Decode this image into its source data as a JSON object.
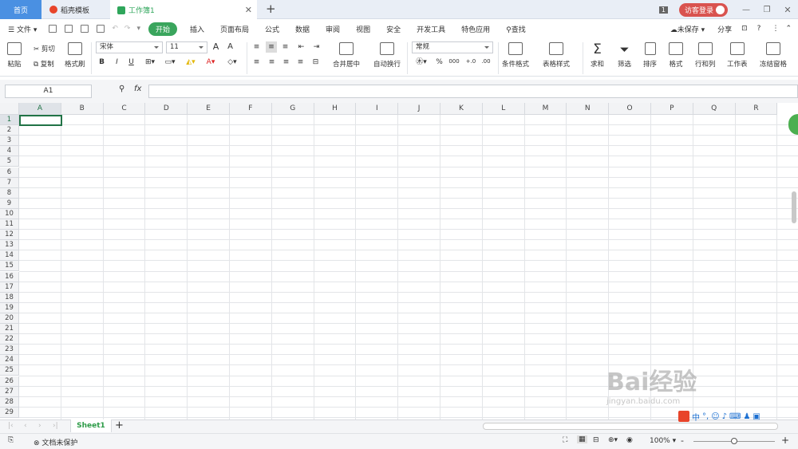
{
  "tabs": {
    "home": "首页",
    "template": "稻壳模板",
    "workbook": "工作簿1",
    "new_tab": "+"
  },
  "titlebar": {
    "window_count": "1",
    "login": "访客登录"
  },
  "menu": {
    "file": "文件",
    "items": [
      "开始",
      "插入",
      "页面布局",
      "公式",
      "数据",
      "审阅",
      "视图",
      "安全",
      "开发工具",
      "特色应用"
    ],
    "search": "查找",
    "unsaved": "未保存",
    "share": "分享",
    "help": "?"
  },
  "ribbon": {
    "paste": "粘贴",
    "cut": "剪切",
    "copy": "复制",
    "format_painter": "格式刷",
    "font_name": "宋体",
    "font_size": "11",
    "bold": "B",
    "italic": "I",
    "underline": "U",
    "merge": "合并居中",
    "wrap": "自动换行",
    "number_format": "常规",
    "percent": "%",
    "thousands": "000",
    "inc_dec": "+.0",
    "dec_dec": ".00",
    "cond_format": "条件格式",
    "table_style": "表格样式",
    "sum": "求和",
    "filter": "筛选",
    "sort": "排序",
    "format": "格式",
    "rowcol": "行和列",
    "worksheet": "工作表",
    "freeze": "冻结窗格"
  },
  "formula": {
    "cell_ref": "A1",
    "fx": "fx"
  },
  "columns": [
    "A",
    "B",
    "C",
    "D",
    "E",
    "F",
    "G",
    "H",
    "I",
    "J",
    "K",
    "L",
    "M",
    "N",
    "O",
    "P",
    "Q",
    "R"
  ],
  "rows": [
    "1",
    "2",
    "3",
    "4",
    "5",
    "6",
    "7",
    "8",
    "9",
    "10",
    "11",
    "12",
    "13",
    "14",
    "15",
    "16",
    "17",
    "18",
    "19",
    "20",
    "21",
    "22",
    "23",
    "24",
    "25",
    "26",
    "27",
    "28",
    "29"
  ],
  "sheet": {
    "name": "Sheet1",
    "add": "+"
  },
  "status": {
    "protect": "文档未保护",
    "zoom": "100%",
    "zoom_minus": "-",
    "zoom_plus": "+"
  },
  "watermark": {
    "text": "Bai经验",
    "sub": "jingyan.baidu.com"
  },
  "colors": {
    "accent_green": "#3aa55d",
    "home_tab": "#4a90e2",
    "sheet_green": "#2c9b47",
    "login_red": "#d9534f"
  }
}
